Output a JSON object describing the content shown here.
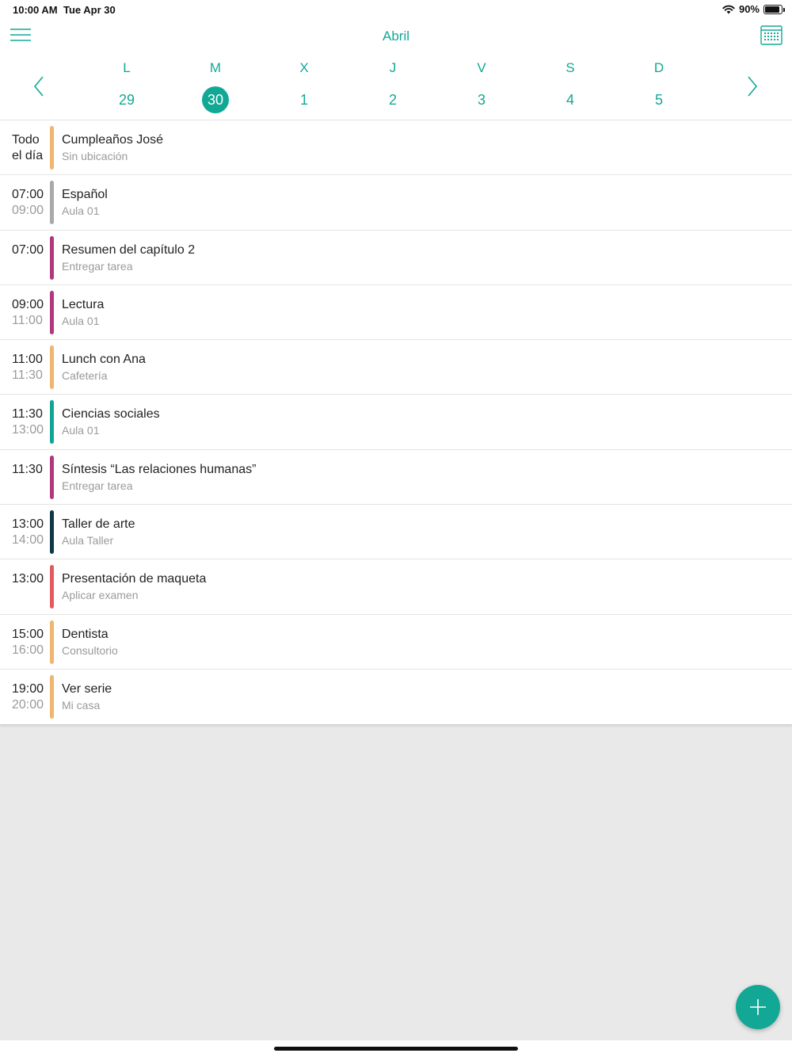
{
  "status": {
    "time": "10:00 AM",
    "date": "Tue Apr 30",
    "battery": "90%",
    "battery_level": 0.9
  },
  "header": {
    "month": "Abril"
  },
  "icons": {
    "menu": "menu-icon",
    "calendar": "calendar-grid-icon",
    "prev": "chevron-left-icon",
    "next": "chevron-right-icon",
    "add": "plus-icon"
  },
  "colors": {
    "accent": "#13a896",
    "orange": "#eeb66f",
    "gray": "#a9a9a9",
    "magenta": "#b0387f",
    "teal": "#12a596",
    "navy": "#0f3849",
    "red": "#e35b61"
  },
  "week": {
    "days": [
      {
        "letter": "L",
        "number": "29"
      },
      {
        "letter": "M",
        "number": "30",
        "selected": true
      },
      {
        "letter": "X",
        "number": "1"
      },
      {
        "letter": "J",
        "number": "2"
      },
      {
        "letter": "V",
        "number": "3"
      },
      {
        "letter": "S",
        "number": "4"
      },
      {
        "letter": "D",
        "number": "5"
      }
    ]
  },
  "events": [
    {
      "start": "Todo",
      "end": "el día",
      "end_dark": true,
      "title": "Cumpleaños José",
      "subtitle": "Sin ubicación",
      "color": "#eeb66f"
    },
    {
      "start": "07:00",
      "end": "09:00",
      "title": "Español",
      "subtitle": "Aula 01",
      "color": "#a9a9a9"
    },
    {
      "start": "07:00",
      "end": "",
      "title": "Resumen del capítulo 2",
      "subtitle": "Entregar tarea",
      "color": "#b0387f"
    },
    {
      "start": "09:00",
      "end": "11:00",
      "title": "Lectura",
      "subtitle": "Aula 01",
      "color": "#b0387f"
    },
    {
      "start": "11:00",
      "end": "11:30",
      "title": "Lunch con Ana",
      "subtitle": "Cafetería",
      "color": "#eeb66f"
    },
    {
      "start": "11:30",
      "end": "13:00",
      "title": "Ciencias sociales",
      "subtitle": "Aula 01",
      "color": "#12a596"
    },
    {
      "start": "11:30",
      "end": "",
      "title": "Síntesis “Las relaciones humanas”",
      "subtitle": "Entregar tarea",
      "color": "#b0387f"
    },
    {
      "start": "13:00",
      "end": "14:00",
      "title": "Taller de arte",
      "subtitle": "Aula Taller",
      "color": "#0f3849"
    },
    {
      "start": "13:00",
      "end": "",
      "title": "Presentación de maqueta",
      "subtitle": "Aplicar examen",
      "color": "#e35b61"
    },
    {
      "start": "15:00",
      "end": "16:00",
      "title": "Dentista",
      "subtitle": "Consultorio",
      "color": "#eeb66f"
    },
    {
      "start": "19:00",
      "end": "20:00",
      "title": "Ver serie",
      "subtitle": "Mi casa",
      "color": "#eeb66f"
    }
  ]
}
